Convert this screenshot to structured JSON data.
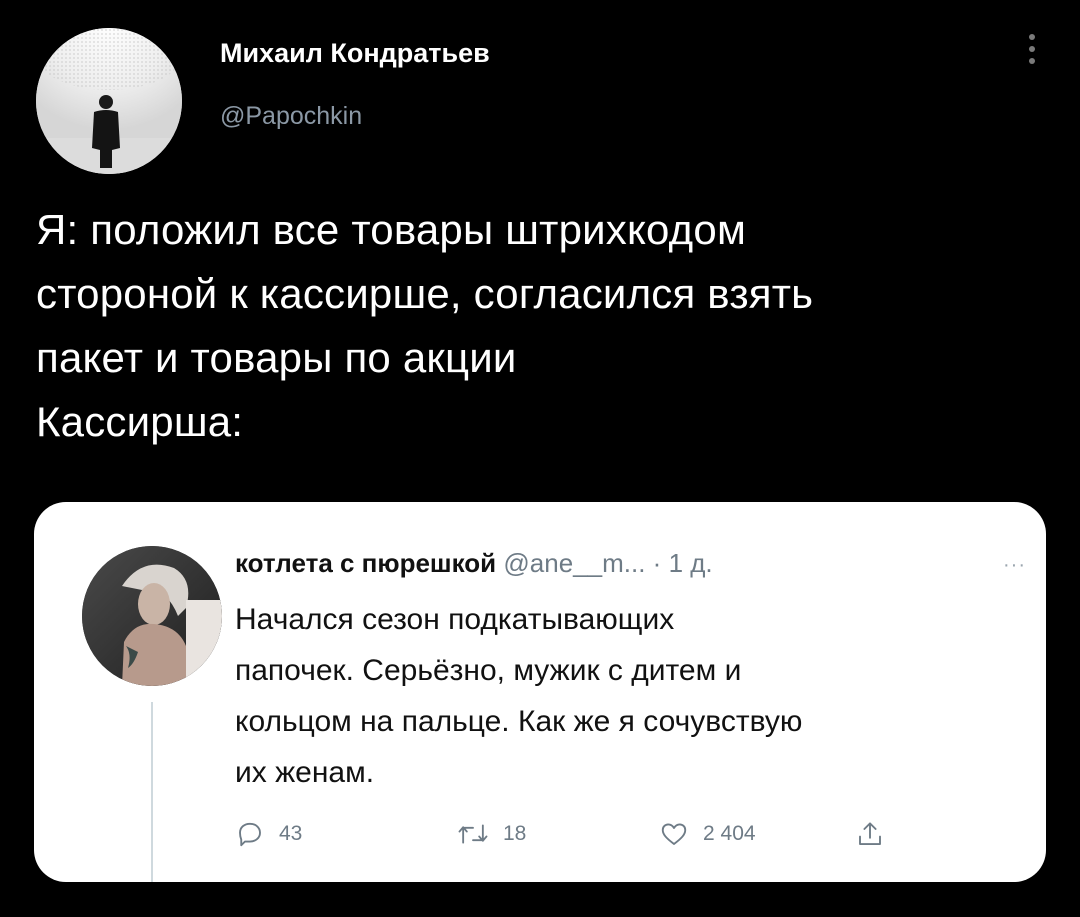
{
  "tweet": {
    "author_name": "Михаил Кондратьев",
    "author_handle": "@Papochkin",
    "text_lines": [
      "Я: положил все товары штрихкодом",
      "стороной к кассирше, согласился взять",
      "пакет и товары по акции",
      "Кассирша:"
    ]
  },
  "quoted_tweet": {
    "author_name": "котлета с пюрешкой",
    "author_handle": "@ane__m...",
    "separator": "·",
    "time": "1 д.",
    "more": "···",
    "text_lines": [
      "Начался сезон подкатывающих",
      "папочек. Серьёзно, мужик с дитем и",
      "кольцом на пальце. Как же я сочувствую",
      "их женам."
    ],
    "actions": {
      "replies": "43",
      "retweets": "18",
      "likes": "2 404"
    }
  },
  "icons": {
    "more_menu": "vertical-dots-icon",
    "reply": "reply-icon",
    "retweet": "retweet-icon",
    "like": "heart-icon",
    "share": "share-icon"
  },
  "colors": {
    "background": "#000000",
    "card": "#ffffff",
    "secondary_text": "#8b98a5"
  }
}
